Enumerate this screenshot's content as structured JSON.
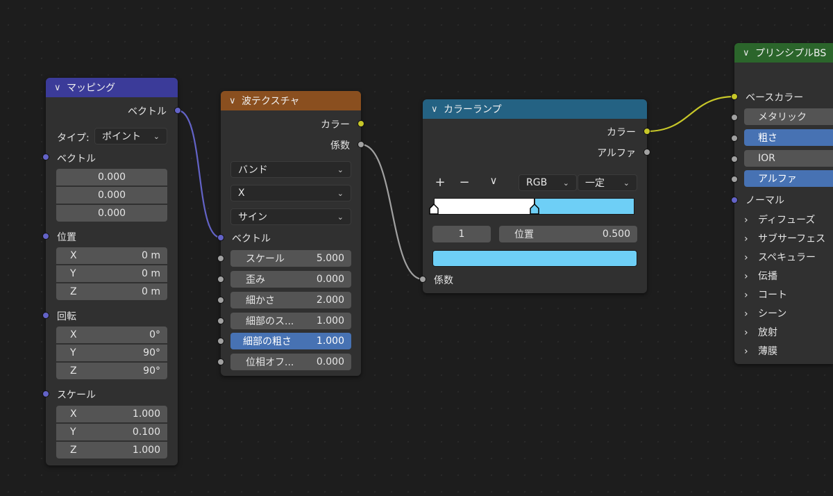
{
  "mapping": {
    "title": "マッピング",
    "output_vector": "ベクトル",
    "type_label": "タイプ:",
    "type_value": "ポイント",
    "vector_label": "ベクトル",
    "vector_values": [
      "0.000",
      "0.000",
      "0.000"
    ],
    "location_label": "位置",
    "location": [
      {
        "axis": "X",
        "value": "0 m"
      },
      {
        "axis": "Y",
        "value": "0 m"
      },
      {
        "axis": "Z",
        "value": "0 m"
      }
    ],
    "rotation_label": "回転",
    "rotation": [
      {
        "axis": "X",
        "value": "0°"
      },
      {
        "axis": "Y",
        "value": "90°"
      },
      {
        "axis": "Z",
        "value": "90°"
      }
    ],
    "scale_label": "スケール",
    "scale": [
      {
        "axis": "X",
        "value": "1.000"
      },
      {
        "axis": "Y",
        "value": "0.100"
      },
      {
        "axis": "Z",
        "value": "1.000"
      }
    ]
  },
  "wave": {
    "title": "波テクスチャ",
    "out_color": "カラー",
    "out_fac": "係数",
    "wave_type": "バンド",
    "direction": "X",
    "profile": "サイン",
    "vector_label": "ベクトル",
    "inputs": [
      {
        "label": "スケール",
        "value": "5.000"
      },
      {
        "label": "歪み",
        "value": "0.000"
      },
      {
        "label": "細かさ",
        "value": "2.000"
      },
      {
        "label": "細部のス...",
        "value": "1.000"
      },
      {
        "label": "細部の粗さ",
        "value": "1.000"
      },
      {
        "label": "位相オフ...",
        "value": "0.000"
      }
    ]
  },
  "ramp": {
    "title": "カラーランプ",
    "out_color": "カラー",
    "out_alpha": "アルファ",
    "add_icon": "plus-icon",
    "remove_icon": "minus-icon",
    "menu_icon": "chevron-down-icon",
    "color_mode": "RGB",
    "interpolation": "一定",
    "active_index": "1",
    "position_label": "位置",
    "position_value": "0.500",
    "stop_position": 0.5,
    "colors": {
      "left": "#ffffff",
      "right": "#6ecff6"
    },
    "in_fac": "係数"
  },
  "principled": {
    "title": "プリンシプルBS",
    "base_color": "ベースカラー",
    "fields": [
      {
        "label": "メタリック",
        "highlight": false
      },
      {
        "label": "粗さ",
        "highlight": true
      },
      {
        "label": "IOR",
        "highlight": false
      },
      {
        "label": "アルファ",
        "highlight": true
      }
    ],
    "normal": "ノーマル",
    "panels": [
      "ディフューズ",
      "サブサーフェス",
      "スペキュラー",
      "伝播",
      "コート",
      "シーン",
      "放射",
      "薄膜"
    ]
  },
  "colors": {
    "mapping_header": "#3b3b99",
    "wave_header": "#8a4f1f",
    "ramp_header": "#246283",
    "principled_header": "#2b652b",
    "vector_socket": "#6363c7",
    "color_socket": "#c7c729",
    "float_socket": "#a1a1a1",
    "highlight_field": "#4772b3"
  }
}
